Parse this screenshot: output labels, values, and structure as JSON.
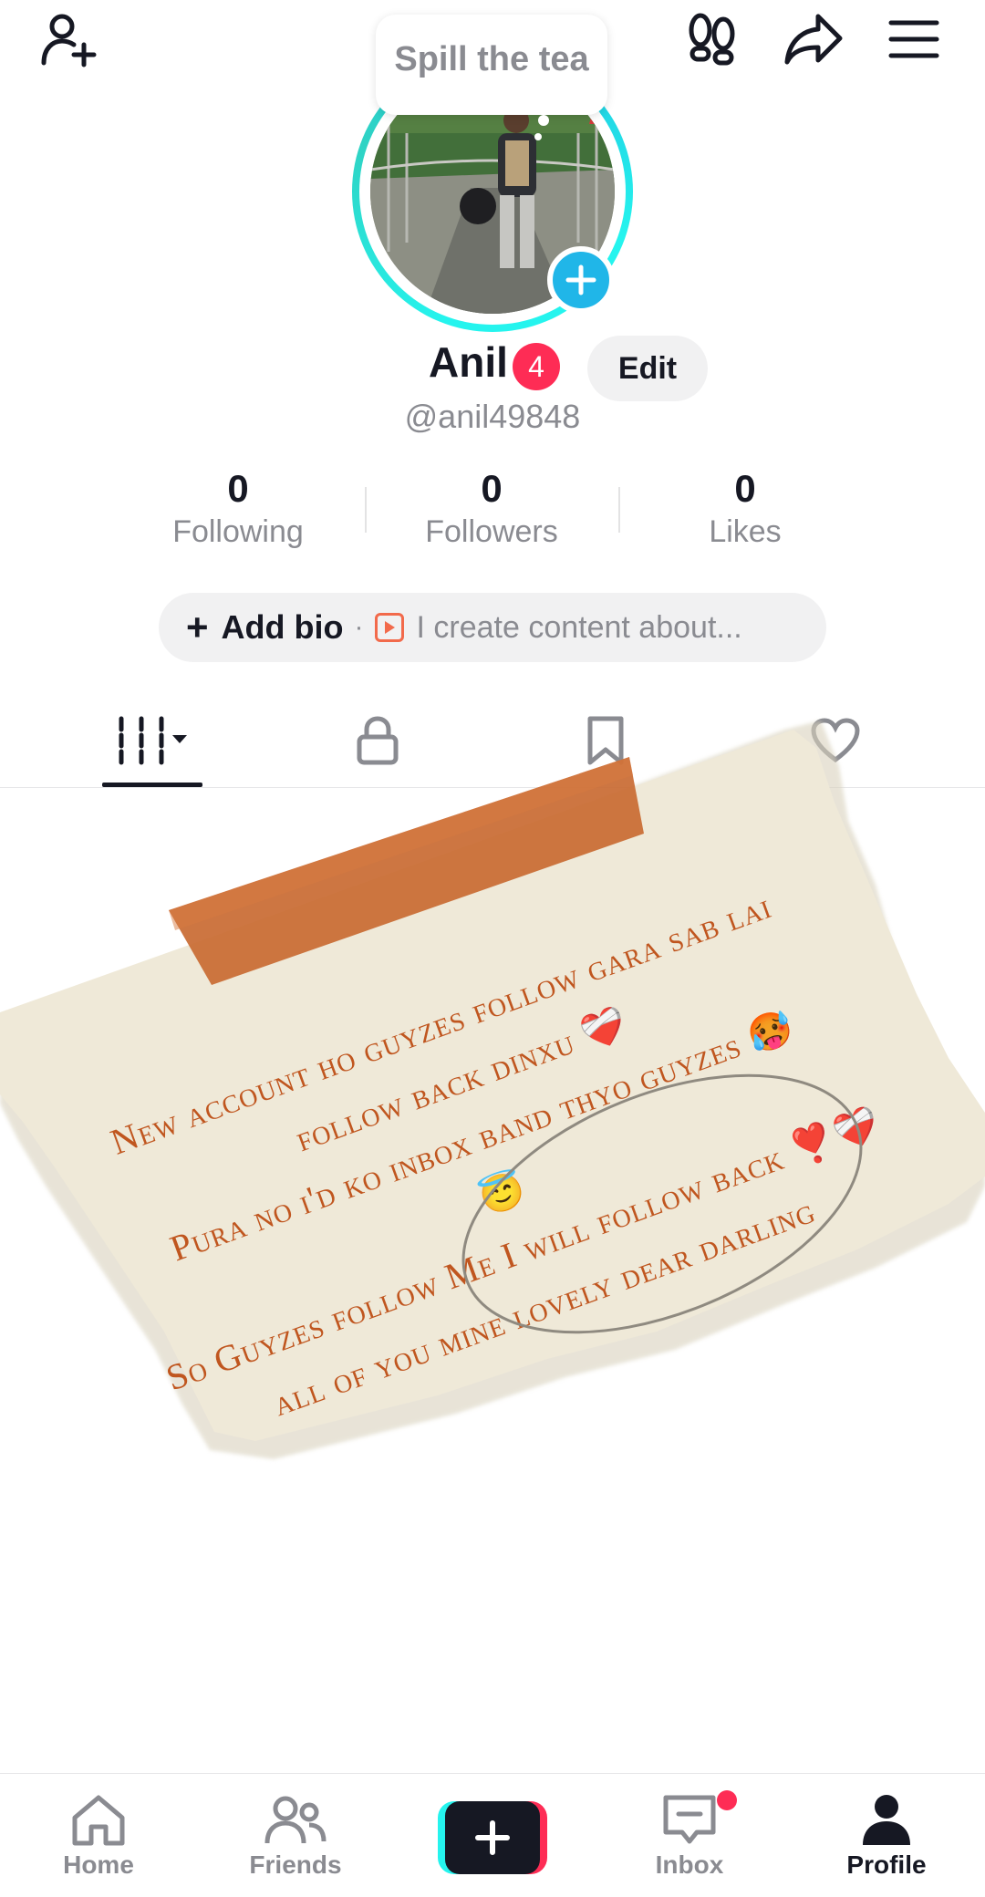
{
  "header": {
    "tooltip_text": "Spill the tea",
    "icons": [
      "add-friend-icon",
      "footprint-icon",
      "share-icon",
      "menu-icon"
    ]
  },
  "profile": {
    "display_name": "Anil",
    "badge_count": "4",
    "edit_label": "Edit",
    "handle": "@anil49848"
  },
  "stats": [
    {
      "value": "0",
      "label": "Following"
    },
    {
      "value": "0",
      "label": "Followers"
    },
    {
      "value": "0",
      "label": "Likes"
    }
  ],
  "bio": {
    "add_label": "Add bio",
    "separator": "·",
    "hint": "I create content about..."
  },
  "tabs": [
    "videos-grid",
    "private",
    "saved",
    "liked"
  ],
  "note": {
    "lines": [
      "New account ho guyzes follow gara sab lai",
      "follow back dinxu ❤️‍🩹",
      "Pura no i'd ko inbox band thyo guyzes 🥵",
      "😇",
      "So Guyzes follow Me I will follow back ❣️❤️‍🩹",
      "all of  you mine lovely dear darling"
    ]
  },
  "bottom_nav": {
    "home": "Home",
    "friends": "Friends",
    "inbox": "Inbox",
    "profile": "Profile"
  },
  "colors": {
    "accent_red": "#fe2c55",
    "accent_cyan": "#25f4ee",
    "note_text": "#c0561f"
  }
}
